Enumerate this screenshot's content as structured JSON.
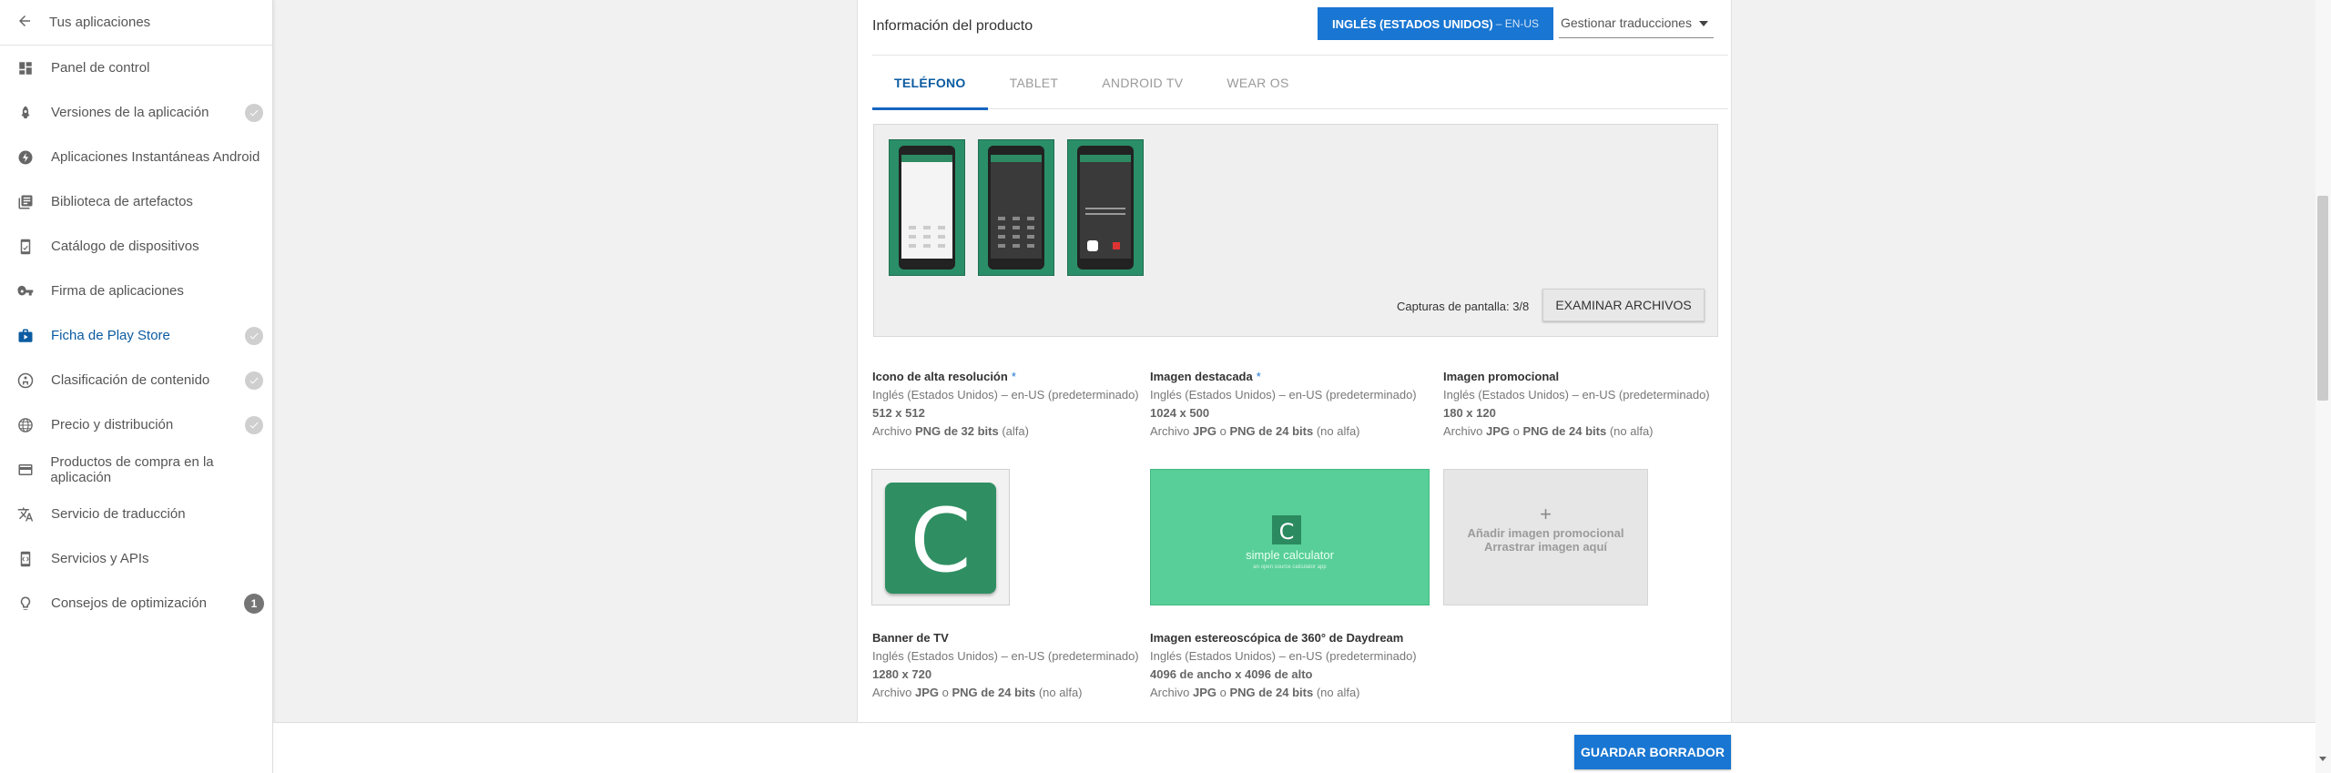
{
  "sidebar": {
    "back_label": "Tus aplicaciones",
    "items": [
      {
        "label": "Panel de control",
        "icon": "dashboard-icon",
        "check": false
      },
      {
        "label": "Versiones de la aplicación",
        "icon": "rocket-icon",
        "check": true
      },
      {
        "label": "Aplicaciones Instantáneas Android",
        "icon": "bolt-icon",
        "check": false
      },
      {
        "label": "Biblioteca de artefactos",
        "icon": "library-icon",
        "check": false
      },
      {
        "label": "Catálogo de dispositivos",
        "icon": "device-catalog-icon",
        "check": false
      },
      {
        "label": "Firma de aplicaciones",
        "icon": "key-icon",
        "check": false
      },
      {
        "label": "Ficha de Play Store",
        "icon": "store-icon",
        "check": true,
        "active": true
      },
      {
        "label": "Clasificación de contenido",
        "icon": "rating-icon",
        "check": true
      },
      {
        "label": "Precio y distribución",
        "icon": "globe-icon",
        "check": true
      },
      {
        "label": "Productos de compra en la aplicación",
        "icon": "card-icon",
        "check": false
      },
      {
        "label": "Servicio de traducción",
        "icon": "translate-icon",
        "check": false
      },
      {
        "label": "Servicios y APIs",
        "icon": "api-icon",
        "check": false
      },
      {
        "label": "Consejos de optimización",
        "icon": "lightbulb-icon",
        "badge": "1"
      }
    ]
  },
  "product": {
    "title": "Información del producto",
    "language_button": "INGLÉS (ESTADOS UNIDOS)",
    "language_code": "– EN-US",
    "manage_translations": "Gestionar traducciones"
  },
  "tabs": [
    "TELÉFONO",
    "TABLET",
    "ANDROID TV",
    "WEAR OS"
  ],
  "screenshots": {
    "count_label": "Capturas de pantalla: 3/8",
    "browse_button": "EXAMINAR ARCHIVOS"
  },
  "assets": {
    "hires": {
      "title": "Icono de alta resolución",
      "required": "*",
      "lang": "Inglés (Estados Unidos) – en-US (predeterminado)",
      "dims": "512 x 512",
      "file_prefix": "Archivo ",
      "file_bold": "PNG de 32 bits",
      "file_suffix": " (alfa)",
      "icon_letter": "C"
    },
    "featured": {
      "title": "Imagen destacada",
      "required": "*",
      "lang": "Inglés (Estados Unidos) – en-US (predeterminado)",
      "dims": "1024 x 500",
      "file_prefix": "Archivo ",
      "file_bold1": "JPG",
      "file_mid": " o ",
      "file_bold2": "PNG de 24 bits",
      "file_suffix": " (no alfa)",
      "logo_letter": "C",
      "app_name": "simple calculator",
      "app_sub": "an open source calculator app"
    },
    "promo": {
      "title": "Imagen promocional",
      "lang": "Inglés (Estados Unidos) – en-US (predeterminado)",
      "dims": "180 x 120",
      "file_prefix": "Archivo ",
      "file_bold1": "JPG",
      "file_mid": " o ",
      "file_bold2": "PNG de 24 bits",
      "file_suffix": " (no alfa)",
      "plus": "+",
      "add_label": "Añadir imagen promocional",
      "drag_label": "Arrastrar imagen aquí"
    },
    "tv": {
      "title": "Banner de TV",
      "lang": "Inglés (Estados Unidos) – en-US (predeterminado)",
      "dims": "1280 x 720",
      "file_prefix": "Archivo ",
      "file_bold1": "JPG",
      "file_mid": " o ",
      "file_bold2": "PNG de 24 bits",
      "file_suffix": " (no alfa)"
    },
    "daydream": {
      "title": "Imagen estereoscópica de 360° de Daydream",
      "lang": "Inglés (Estados Unidos) – en-US (predeterminado)",
      "dims": "4096 de ancho x 4096 de alto",
      "file_prefix": "Archivo ",
      "file_bold1": "JPG",
      "file_mid": " o ",
      "file_bold2": "PNG de 24 bits",
      "file_suffix": " (no alfa)"
    }
  },
  "footer": {
    "save_draft": "GUARDAR BORRADOR"
  },
  "colors": {
    "accent": "#1976d2",
    "active_nav": "#0b5ba1",
    "app_green": "#2f8f62",
    "feature_green": "#58cf98"
  }
}
